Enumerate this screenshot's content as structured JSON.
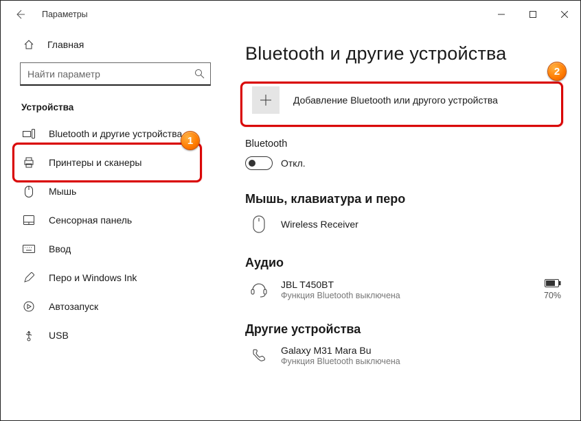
{
  "window": {
    "title": "Параметры"
  },
  "sidebar": {
    "home": "Главная",
    "search_placeholder": "Найти параметр",
    "category": "Устройства",
    "items": [
      "Bluetooth и другие устройства",
      "Принтеры и сканеры",
      "Мышь",
      "Сенсорная панель",
      "Ввод",
      "Перо и Windows Ink",
      "Автозапуск",
      "USB"
    ]
  },
  "main": {
    "title": "Bluetooth и другие устройства",
    "add_device": "Добавление Bluetooth или другого устройства",
    "bt_label": "Bluetooth",
    "bt_state": "Откл.",
    "groups": {
      "input": {
        "title": "Мышь, клавиатура и перо",
        "device1_name": "Wireless Receiver"
      },
      "audio": {
        "title": "Аудио",
        "device1_name": "JBL T450BT",
        "device1_sub": "Функция Bluetooth выключена",
        "device1_battery": "70%"
      },
      "other": {
        "title": "Другие устройства",
        "device1_name": "Galaxy M31 Mara Bu",
        "device1_sub": "Функция Bluetooth выключена"
      }
    }
  },
  "annotations": {
    "badge1": "1",
    "badge2": "2"
  }
}
